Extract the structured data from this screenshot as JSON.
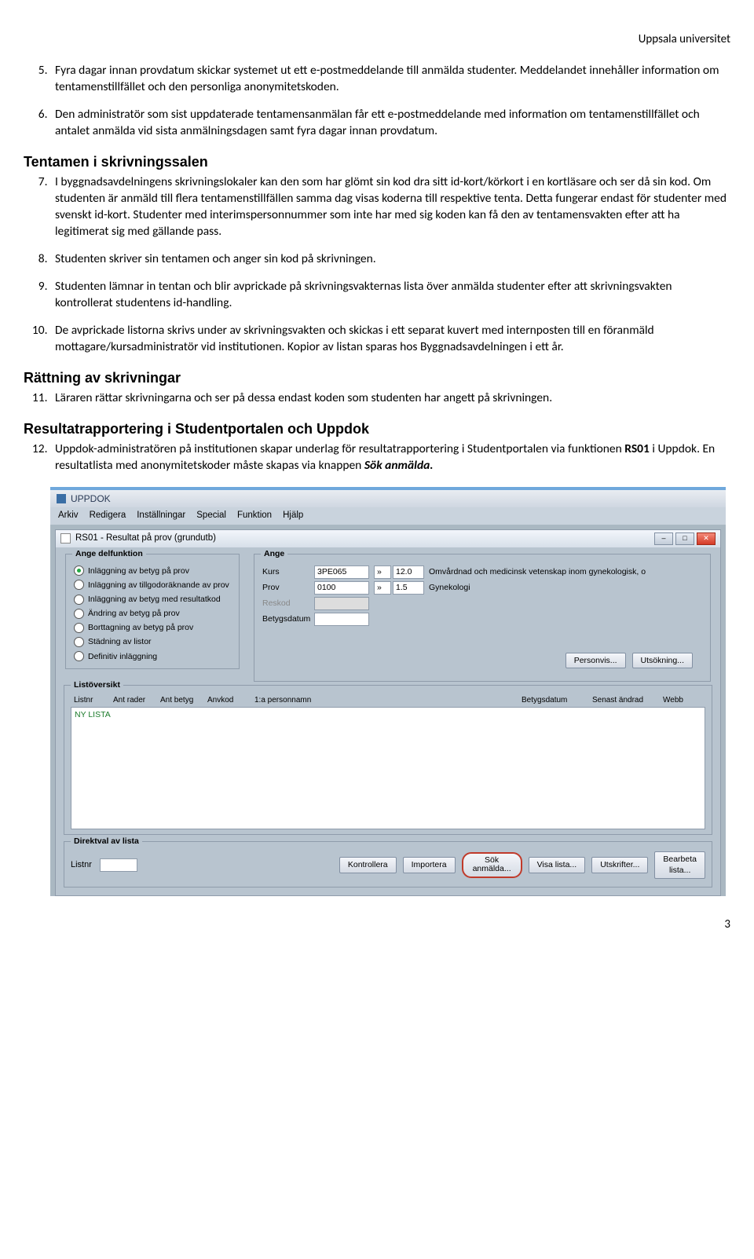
{
  "header_right": "Uppsala universitet",
  "list5": {
    "num": "5.",
    "text": "Fyra dagar innan provdatum skickar systemet ut ett e-postmeddelande till anmälda studenter. Meddelandet innehåller information om tentamenstillfället och den personliga anonymitetskoden."
  },
  "list6": {
    "num": "6.",
    "text": "Den administratör som sist uppdaterade tentamensanmälan får ett e-postmeddelande med information om tentamenstillfället och antalet anmälda vid sista anmälningsdagen samt fyra dagar innan provdatum."
  },
  "h_tentamen": "Tentamen i skrivningssalen",
  "list7": {
    "num": "7.",
    "text": "I byggnadsavdelningens skrivningslokaler kan den som har glömt sin kod dra sitt id-kort/körkort i en kortläsare och ser då sin kod. Om studenten är anmäld till flera tentamenstillfällen samma dag visas koderna till respektive tenta. Detta fungerar endast för studenter med svenskt id-kort. Studenter med interimspersonnummer som inte har med sig koden kan få den av tentamensvakten efter att ha legitimerat sig med gällande pass."
  },
  "list8": {
    "num": "8.",
    "text": "Studenten skriver sin tentamen och anger sin kod på skrivningen."
  },
  "list9": {
    "num": "9.",
    "text": "Studenten lämnar in tentan och blir avprickade på skrivningsvakternas lista över anmälda studenter efter att skrivningsvakten kontrollerat studentens id-handling."
  },
  "list10": {
    "num": "10.",
    "text": "De avprickade listorna skrivs under av skrivningsvakten och skickas i ett separat kuvert med internposten till en föranmäld mottagare/kursadministratör vid institutionen. Kopior av listan sparas hos Byggnadsavdelningen i ett år."
  },
  "h_rattning": "Rättning av skrivningar",
  "list11": {
    "num": "11.",
    "text": "Läraren rättar skrivningarna och ser på dessa endast koden som studenten har angett på skrivningen."
  },
  "h_resultat": "Resultatrapportering i Studentportalen och Uppdok",
  "list12": {
    "num": "12.",
    "text_a": "Uppdok-administratören på institutionen skapar underlag för resultatrapportering i Studentportalen via funktionen ",
    "bold": "RS01",
    "text_b": " i Uppdok. En resultatlista med anonymitetskoder måste skapas via knappen ",
    "bold2": "Sök anmälda.",
    "text_c": ""
  },
  "app": {
    "title": "UPPDOK",
    "menu": [
      "Arkiv",
      "Redigera",
      "Inställningar",
      "Special",
      "Funktion",
      "Hjälp"
    ],
    "subwin_title": "RS01 - Resultat på prov  (grundutb)",
    "group1_title": "Ange delfunktion",
    "radios": [
      "Inläggning av betyg på prov",
      "Inläggning av tillgodoräknande av prov",
      "Inläggning av betyg med resultatkod",
      "Ändring av betyg på prov",
      "Borttagning av betyg på prov",
      "Städning av listor",
      "Definitiv inläggning"
    ],
    "group2_title": "Ange",
    "labels": {
      "kurs": "Kurs",
      "prov": "Prov",
      "reskod": "Reskod",
      "betygsdatum": "Betygsdatum"
    },
    "kurs_val": "3PE065",
    "kurs_pts": "12.0",
    "kurs_desc": "Omvårdnad och medicinsk vetenskap inom gynekologisk, o",
    "prov_val": "0100",
    "prov_pts": "1.5",
    "prov_desc": "Gynekologi",
    "btn_personvis": "Personvis...",
    "btn_utsokning": "Utsökning...",
    "list_title": "Listöversikt",
    "list_cols": [
      "Listnr",
      "Ant rader",
      "Ant betyg",
      "Anvkod",
      "1:a personnamn",
      "Betygsdatum",
      "Senast ändrad",
      "Webb"
    ],
    "list_placeholder": "NY LISTA",
    "bottom_title": "Direktval av lista",
    "bottom_listnr": "Listnr",
    "btn_kontrollera": "Kontrollera",
    "btn_importera": "Importera",
    "btn_sok": "Sök\nanmälda...",
    "btn_visa": "Visa lista...",
    "btn_utskrifter": "Utskrifter...",
    "btn_bearbeta": "Bearbeta\nlista..."
  },
  "page_num": "3"
}
